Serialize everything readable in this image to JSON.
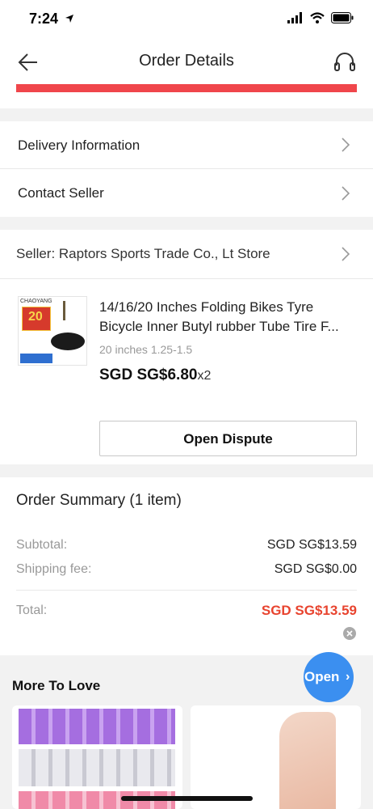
{
  "status": {
    "time": "7:24"
  },
  "header": {
    "title": "Order Details"
  },
  "menu": {
    "delivery": "Delivery Information",
    "contact": "Contact Seller"
  },
  "seller": {
    "label": "Seller: Raptors Sports Trade Co., Lt Store"
  },
  "product": {
    "name_line1": "14/16/20 Inches Folding Bikes Tyre",
    "name_line2": "Bicycle Inner Butyl rubber Tube Tire F...",
    "variant": "20 inches 1.25-1.5",
    "price": "SGD SG$6.80",
    "qty": "x2",
    "thumb_brand": "CHAOYANG",
    "thumb_size": "20"
  },
  "actions": {
    "open_dispute": "Open Dispute"
  },
  "summary": {
    "title": "Order Summary (1 item)",
    "subtotal_label": "Subtotal:",
    "subtotal_value": "SGD SG$13.59",
    "shipping_label": "Shipping fee:",
    "shipping_value": "SGD SG$0.00",
    "total_label": "Total:",
    "total_value": "SGD SG$13.59"
  },
  "more": {
    "title": "More To Love"
  },
  "fab": {
    "label": "Open"
  },
  "colors": {
    "accent_red": "#f0464b",
    "total_red": "#e8442f",
    "fab_blue": "#3b8ff0"
  }
}
